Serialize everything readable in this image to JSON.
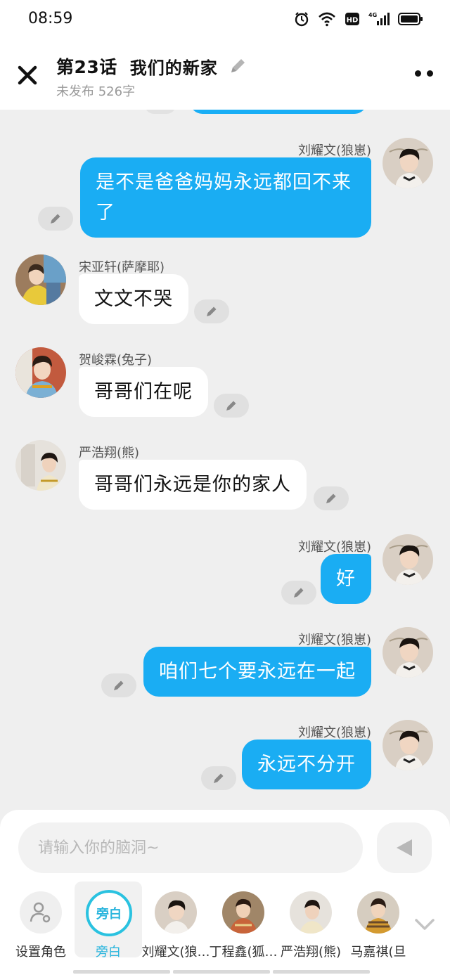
{
  "status_bar": {
    "time": "08:59",
    "network": "4G"
  },
  "header": {
    "episode": "第23话",
    "title": "我们的新家",
    "status": "未发布",
    "word_count": "526字"
  },
  "messages": [
    {
      "side": "right",
      "name": "刘耀文(狼崽)",
      "lines": [
        "是不是爸爸妈妈永远都回不来",
        "了"
      ]
    },
    {
      "side": "left",
      "name": "宋亚轩(萨摩耶)",
      "lines": [
        "文文不哭"
      ]
    },
    {
      "side": "left",
      "name": "贺峻霖(兔子)",
      "lines": [
        "哥哥们在呢"
      ]
    },
    {
      "side": "left",
      "name": "严浩翔(熊)",
      "lines": [
        "哥哥们永远是你的家人"
      ]
    },
    {
      "side": "right",
      "name": "刘耀文(狼崽)",
      "lines": [
        "好"
      ]
    },
    {
      "side": "right",
      "name": "刘耀文(狼崽)",
      "lines": [
        "咱们七个要永远在一起"
      ]
    },
    {
      "side": "right",
      "name": "刘耀文(狼崽)",
      "lines": [
        "永远不分开"
      ]
    }
  ],
  "composer": {
    "placeholder": "请输入你的脑洞~",
    "roles": [
      {
        "label": "设置角色",
        "icon": "person-gear-icon"
      },
      {
        "label": "旁白",
        "ring_text": "旁白",
        "active": true
      },
      {
        "label": "刘耀文(狼…"
      },
      {
        "label": "丁程鑫(狐…"
      },
      {
        "label": "严浩翔(熊)"
      },
      {
        "label": "马嘉祺(旦"
      }
    ]
  },
  "colors": {
    "accent_blue": "#1aadf3",
    "narration_teal": "#2ab5dd",
    "background": "#efefef"
  }
}
